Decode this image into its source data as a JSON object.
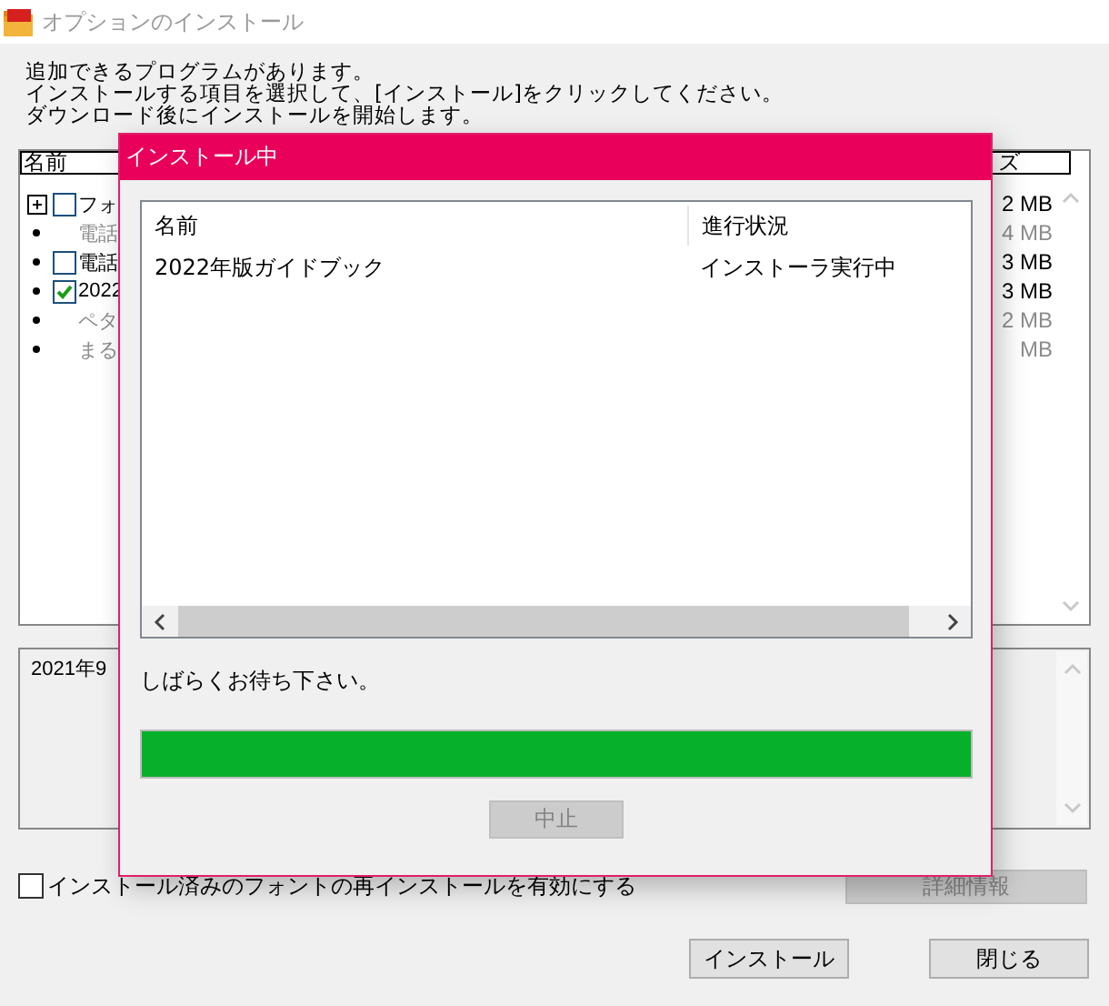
{
  "window": {
    "title": "オプションのインストール"
  },
  "instructions": [
    "追加できるプログラムがあります。",
    "インストールする項目を選択して、[インストール]をクリックしてください。",
    "ダウンロード後にインストールを開始します。"
  ],
  "list": {
    "columns": [
      "名前",
      "ズ"
    ],
    "items": [
      {
        "kind": "group",
        "checked": false,
        "disabled": false,
        "name": "フォ",
        "size": "2 MB"
      },
      {
        "kind": "leaf",
        "disabled": true,
        "name": "電話",
        "size": "4 MB"
      },
      {
        "kind": "option",
        "checked": false,
        "disabled": false,
        "name": "電話",
        "size": "3 MB"
      },
      {
        "kind": "option",
        "checked": true,
        "disabled": false,
        "name": "2022",
        "size": "3 MB"
      },
      {
        "kind": "leaf",
        "disabled": true,
        "name": "ペタ",
        "size": "2 MB"
      },
      {
        "kind": "leaf",
        "disabled": true,
        "name": "まる",
        "size": "MB"
      }
    ]
  },
  "description": "2021年9",
  "reinstall_option": {
    "label": "インストール済みのフォントの再インストールを有効にする",
    "checked": false
  },
  "details_button": {
    "label": "詳細情報",
    "disabled": true
  },
  "buttons": [
    {
      "label": "インストール"
    },
    {
      "label": "閉じる"
    }
  ],
  "dialog": {
    "title": "インストール中",
    "columns": [
      "名前",
      "進行状況"
    ],
    "rows": [
      [
        "2022年版ガイドブック",
        "インストーラ実行中"
      ]
    ],
    "message": "しばらくお待ち下さい。",
    "progress": {
      "level": 1
    },
    "cancel_button": {
      "label": "中止",
      "disabled": true
    }
  }
}
